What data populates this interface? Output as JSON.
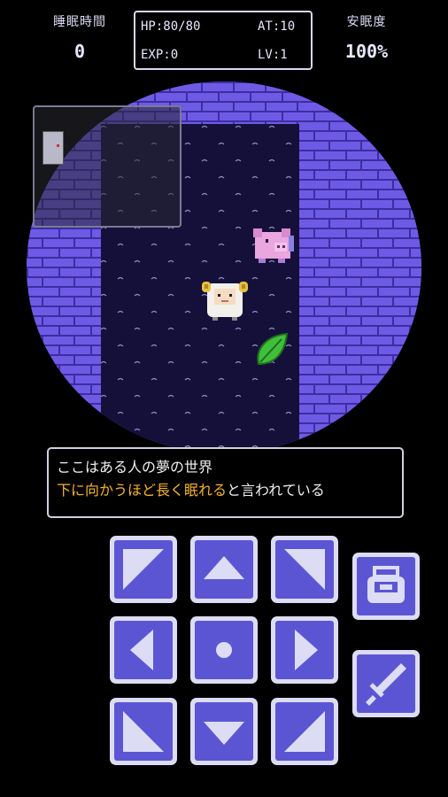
{
  "hud": {
    "sleep_time_label": "睡眠時間",
    "sleep_time_value": "0",
    "comfort_label": "安眠度",
    "comfort_value": "100%",
    "stats": {
      "hp": "HP:80/80",
      "at": "AT:10",
      "exp": "EXP:0",
      "lv": "LV:1"
    }
  },
  "dialog": {
    "line1": "ここはある人の夢の世界",
    "line2_highlight": "下に向かうほど長く眠れる",
    "line2_rest": "と言われている"
  },
  "colors": {
    "brick": "#6f5ae6",
    "mortar": "#3a2fa0",
    "floor": "#14103a",
    "button_face": "#5c55d3",
    "button_border": "#dcdcf5",
    "highlight_text": "#f6b52e"
  },
  "controls": {
    "dpad": [
      "up-left",
      "up",
      "up-right",
      "left",
      "wait",
      "right",
      "down-left",
      "down",
      "down-right"
    ],
    "actions": [
      "inventory-bag",
      "sword-attack"
    ]
  },
  "sprites": [
    "sheep",
    "pink-pig",
    "green-leaf",
    "door"
  ]
}
